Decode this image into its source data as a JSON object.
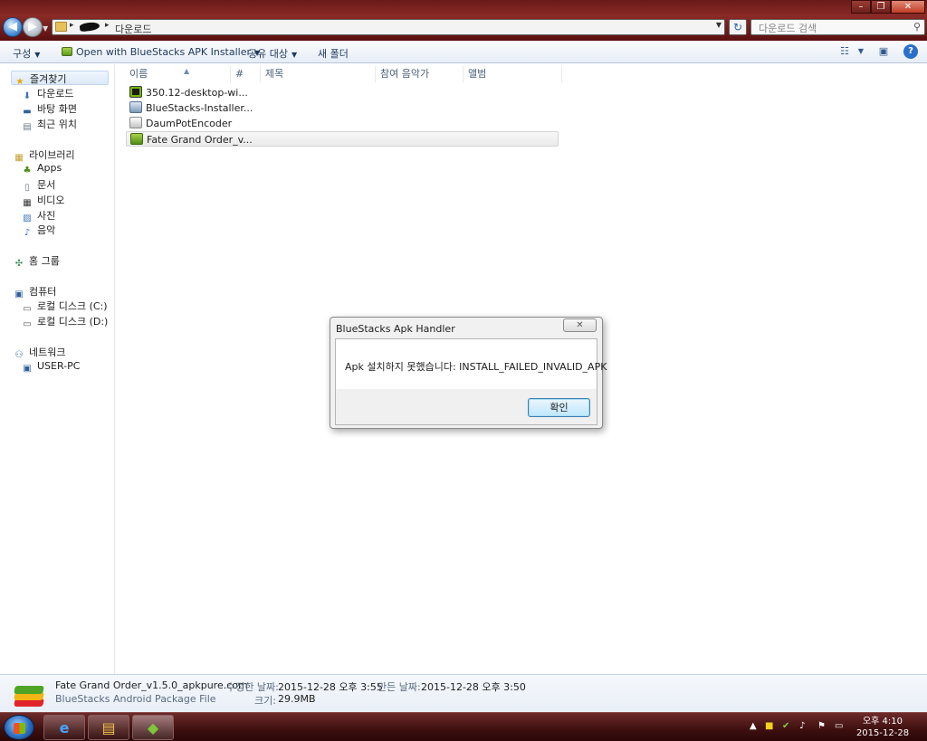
{
  "address": {
    "path_last": "다운로드"
  },
  "search": {
    "placeholder": "다운로드 검색"
  },
  "toolbar": {
    "organize": "구성",
    "open_with": "Open with BlueStacks APK Installer",
    "share_with": "공유 대상",
    "new_folder": "새 폴더"
  },
  "sidebar": {
    "favorites": "즐겨찾기",
    "downloads": "다운로드",
    "desktop": "바탕 화면",
    "recent": "최근 위치",
    "libraries": "라이브러리",
    "apps": "Apps",
    "documents": "문서",
    "videos": "비디오",
    "pictures": "사진",
    "music": "음악",
    "homegroup": "홈 그룹",
    "computer": "컴퓨터",
    "disk_c": "로컬 디스크 (C:)",
    "disk_d": "로컬 디스크 (D:)",
    "network": "네트워크",
    "user_pc": "USER-PC"
  },
  "columns": [
    "이름",
    "#",
    "제목",
    "참여 음악가",
    "앨범"
  ],
  "files": [
    {
      "name": "350.12-desktop-wi...",
      "icon": "nvidia-installer-icon"
    },
    {
      "name": "BlueStacks-Installer...",
      "icon": "bluestacks-installer-icon"
    },
    {
      "name": "DaumPotEncoder",
      "icon": "daum-encoder-icon"
    },
    {
      "name": "Fate Grand Order_v...",
      "icon": "apk-file-icon"
    }
  ],
  "dialog": {
    "title": "BlueStacks Apk Handler",
    "message": "Apk 설치하지 못했습니다: INSTALL_FAILED_INVALID_APK",
    "ok": "확인"
  },
  "details": {
    "filename": "Fate Grand Order_v1.5.0_apkpure.com",
    "filetype": "BlueStacks Android Package File",
    "modified_label": "수정한 날짜:",
    "modified_value": "2015-12-28 오후 3:55",
    "created_label": "만든 날짜:",
    "created_value": "2015-12-28 오후 3:50",
    "size_label": "크기:",
    "size_value": "29.9MB"
  },
  "clock": {
    "time": "오후 4:10",
    "date": "2015-12-28"
  }
}
